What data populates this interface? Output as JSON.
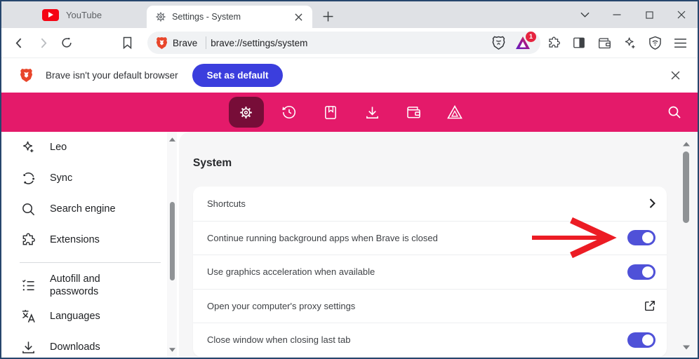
{
  "tab_bar": {
    "tabs": [
      {
        "label": "YouTube",
        "active": false
      },
      {
        "label": "Settings - System",
        "active": true
      }
    ]
  },
  "toolbar": {
    "brand": "Brave",
    "url": "brave://settings/system",
    "rewards_badge": "1"
  },
  "notification": {
    "message": "Brave isn't your default browser",
    "action_label": "Set as default"
  },
  "sidebar": {
    "items": [
      {
        "label": "Leo",
        "icon": "leo-sparkle-icon"
      },
      {
        "label": "Sync",
        "icon": "sync-icon"
      },
      {
        "label": "Search engine",
        "icon": "search-icon"
      },
      {
        "label": "Extensions",
        "icon": "extensions-puzzle-icon"
      },
      {
        "label": "Autofill and passwords",
        "icon": "autofill-list-icon"
      },
      {
        "label": "Languages",
        "icon": "translate-icon"
      },
      {
        "label": "Downloads",
        "icon": "download-icon"
      }
    ]
  },
  "main": {
    "title": "System",
    "rows": [
      {
        "label": "Shortcuts",
        "control": "chevron"
      },
      {
        "label": "Continue running background apps when Brave is closed",
        "control": "toggle",
        "state": "on",
        "annotated": true
      },
      {
        "label": "Use graphics acceleration when available",
        "control": "toggle",
        "state": "on"
      },
      {
        "label": "Open your computer's proxy settings",
        "control": "external-link"
      },
      {
        "label": "Close window when closing last tab",
        "control": "toggle",
        "state": "on"
      }
    ]
  },
  "nav_header_icons": [
    "settings-gear-icon",
    "history-icon",
    "bookmarks-icon",
    "downloads-icon",
    "wallet-icon",
    "rewards-triangle-icon",
    "search-icon"
  ],
  "toolbar_right_icons": [
    "extensions-puzzle-icon",
    "side-panel-icon",
    "wallet-icon",
    "leo-sparkle-icon",
    "vpn-shield-icon",
    "menu-icon"
  ],
  "colors": {
    "accent_pink": "#e41a6a",
    "active_nav_bg": "#770d38",
    "toggle_on": "#4f51d8",
    "primary_button": "#3b3edd",
    "annotation_arrow": "#ec1c24",
    "window_border": "#27466d",
    "tabstrip_bg": "#dfe1e5"
  }
}
